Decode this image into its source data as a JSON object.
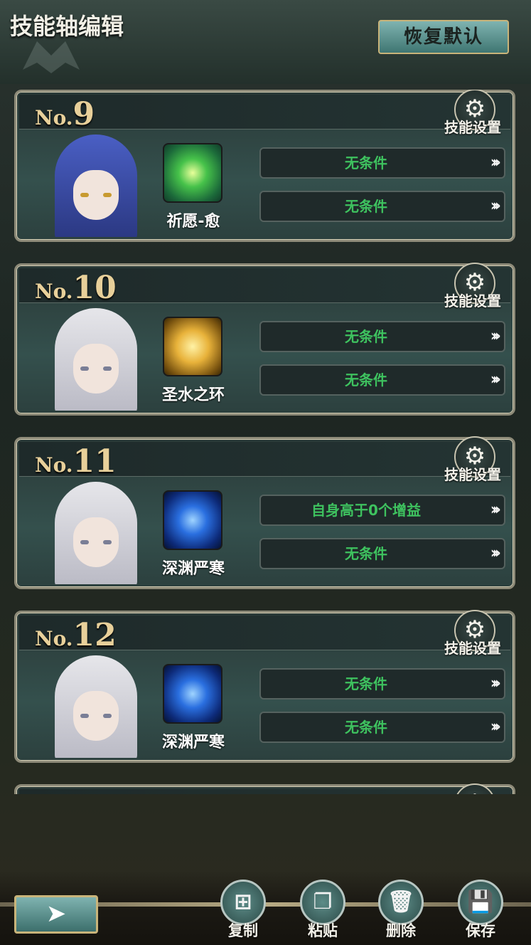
{
  "header": {
    "title": "技能轴编辑",
    "reset_label": "恢复默认"
  },
  "cards": [
    {
      "no_prefix": "No.",
      "no": "9",
      "settings_label": "技能设置",
      "character": "blue-haired-character",
      "skill_name": "祈愿-愈",
      "skill_icon": "green-healing-icon",
      "conditions": [
        "无条件",
        "无条件"
      ]
    },
    {
      "no_prefix": "No.",
      "no": "10",
      "settings_label": "技能设置",
      "character": "white-haired-character",
      "skill_name": "圣水之环",
      "skill_icon": "golden-holy-water-icon",
      "conditions": [
        "无条件",
        "无条件"
      ]
    },
    {
      "no_prefix": "No.",
      "no": "11",
      "settings_label": "技能设置",
      "character": "white-haired-character",
      "skill_name": "深渊严寒",
      "skill_icon": "blue-abyss-frost-icon",
      "conditions": [
        "自身高于0个增益",
        "无条件"
      ]
    },
    {
      "no_prefix": "No.",
      "no": "12",
      "settings_label": "技能设置",
      "character": "white-haired-character",
      "skill_name": "深渊严寒",
      "skill_icon": "blue-abyss-frost-icon",
      "conditions": [
        "无条件",
        "无条件"
      ]
    }
  ],
  "footer": {
    "back_icon": "back-arrow-icon",
    "copy_label": "复制",
    "paste_label": "粘贴",
    "delete_label": "删除",
    "save_label": "保存"
  },
  "colors": {
    "condition_text": "#3ec25f",
    "number_gold": "#e8d09a",
    "button_teal": "#5f9996"
  }
}
